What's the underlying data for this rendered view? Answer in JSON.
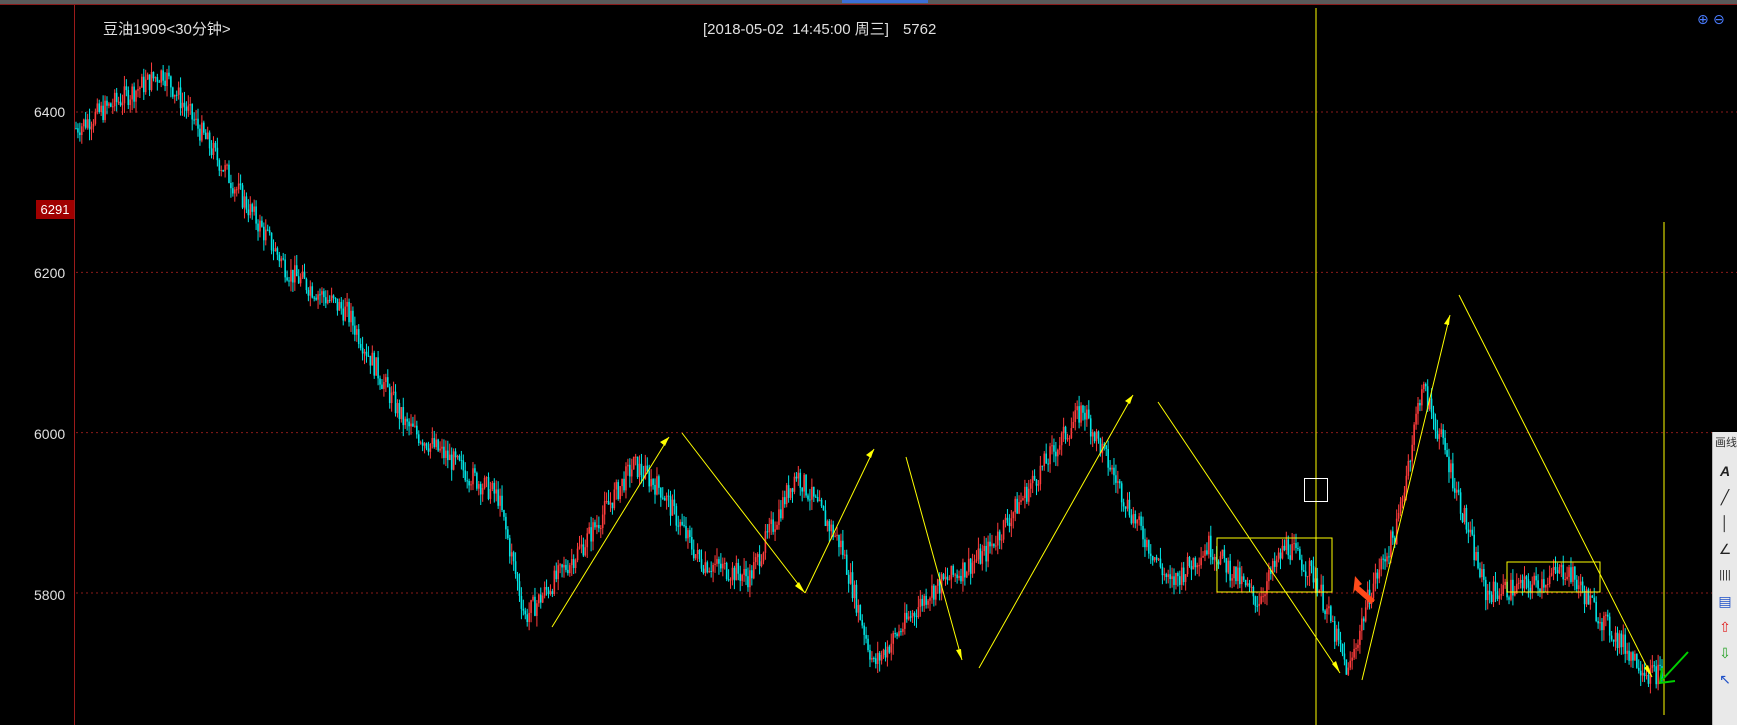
{
  "header": {
    "symbol_title": "豆油1909<30分钟>",
    "cursor_datetime": "[2018-05-02  14:45:00 周三]",
    "cursor_value": "5762"
  },
  "price_axis": {
    "labels": [
      "6400",
      "6200",
      "6000",
      "5800"
    ],
    "current_price": "6291"
  },
  "zoom_controls": {
    "zoom_in_icon": "⊕",
    "zoom_out_icon": "⊖"
  },
  "drawing_toolbar": {
    "title": "画线",
    "tools": [
      {
        "name": "text-tool-icon",
        "glyph": "A"
      },
      {
        "name": "line-tool-icon",
        "glyph": "╱"
      },
      {
        "name": "vertical-line-tool-icon",
        "glyph": "│"
      },
      {
        "name": "angle-tool-icon",
        "glyph": "∠"
      },
      {
        "name": "parallel-lines-tool-icon",
        "glyph": "||||"
      },
      {
        "name": "channel-tool-icon",
        "glyph": "▤"
      },
      {
        "name": "up-arrow-tool-icon",
        "glyph": "⇧"
      },
      {
        "name": "down-arrow-tool-icon",
        "glyph": "⇩"
      },
      {
        "name": "pointer-tool-icon",
        "glyph": "↖"
      }
    ]
  },
  "colors": {
    "background": "#000000",
    "candle_up": "#ff3c3c",
    "candle_down": "#00e5e5",
    "annotation": "#ffff00",
    "grid": "#8a1a1a",
    "current_price_tag": "#a00000"
  },
  "chart_data": {
    "type": "candlestick",
    "title": "豆油1909<30分钟>",
    "ylim": [
      5660,
      6480
    ],
    "y_ticks": [
      5800,
      6000,
      6200,
      6400
    ],
    "grid": true,
    "swing_points": [
      {
        "bar": 0,
        "price": 6380
      },
      {
        "bar": 45,
        "price": 6450
      },
      {
        "bar": 110,
        "price": 6200
      },
      {
        "bar": 140,
        "price": 6150
      },
      {
        "bar": 170,
        "price": 6010
      },
      {
        "bar": 218,
        "price": 5920
      },
      {
        "bar": 232,
        "price": 5770
      },
      {
        "bar": 262,
        "price": 5860
      },
      {
        "bar": 288,
        "price": 5960
      },
      {
        "bar": 302,
        "price": 5930
      },
      {
        "bar": 322,
        "price": 5840
      },
      {
        "bar": 348,
        "price": 5820
      },
      {
        "bar": 372,
        "price": 5950
      },
      {
        "bar": 395,
        "price": 5860
      },
      {
        "bar": 412,
        "price": 5710
      },
      {
        "bar": 440,
        "price": 5800
      },
      {
        "bar": 470,
        "price": 5850
      },
      {
        "bar": 500,
        "price": 5960
      },
      {
        "bar": 520,
        "price": 6030
      },
      {
        "bar": 545,
        "price": 5900
      },
      {
        "bar": 565,
        "price": 5810
      },
      {
        "bar": 585,
        "price": 5860
      },
      {
        "bar": 610,
        "price": 5790
      },
      {
        "bar": 625,
        "price": 5860
      },
      {
        "bar": 640,
        "price": 5820
      },
      {
        "bar": 657,
        "price": 5700
      },
      {
        "bar": 668,
        "price": 5800
      },
      {
        "bar": 682,
        "price": 5880
      },
      {
        "bar": 695,
        "price": 6060
      },
      {
        "bar": 708,
        "price": 5970
      },
      {
        "bar": 728,
        "price": 5800
      },
      {
        "bar": 752,
        "price": 5810
      },
      {
        "bar": 770,
        "price": 5830
      },
      {
        "bar": 790,
        "price": 5760
      },
      {
        "bar": 812,
        "price": 5700
      }
    ],
    "bar_count": 820
  }
}
